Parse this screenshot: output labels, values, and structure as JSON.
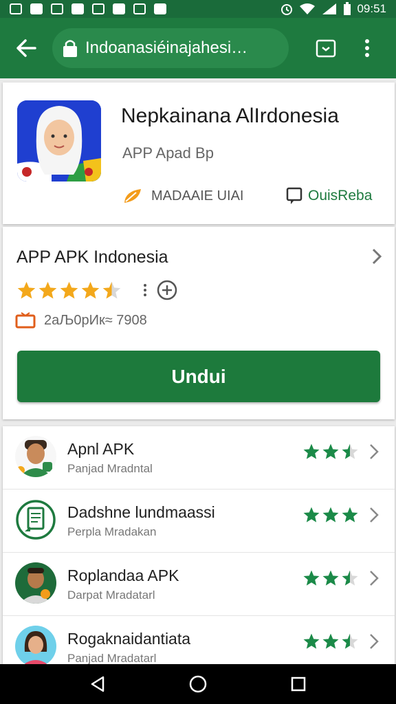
{
  "status_bar": {
    "time": "09:51"
  },
  "toolbar": {
    "url": "Indoanasiéinajahesi…"
  },
  "app": {
    "title": "Nepkainana AlIrdonesia",
    "subtitle": "APP Apad Bp",
    "meta_left": "MADAAIE UIAI",
    "meta_right": "OuisReba"
  },
  "main": {
    "title": "APP APK Indonesia",
    "rating": 4.5,
    "size_text": "2аЉ0рИк≈ 7908",
    "download_label": "Undui"
  },
  "list": [
    {
      "title": "Apnl APK",
      "subtitle": "Panjad Mradntal",
      "rating": 2.5
    },
    {
      "title": "Dadshne lundmaassi",
      "subtitle": "Perpla Mradakan",
      "rating": 3
    },
    {
      "title": "Roplandaa APK",
      "subtitle": "Darpat Mradatarl",
      "rating": 2.5
    },
    {
      "title": "Rogaknaidantiata",
      "subtitle": "Panjad Mradatarl",
      "rating": 2.5
    }
  ],
  "colors": {
    "brand": "#1e7a3f",
    "star_main": "#f3a81b",
    "star_list": "#1b8a48"
  }
}
